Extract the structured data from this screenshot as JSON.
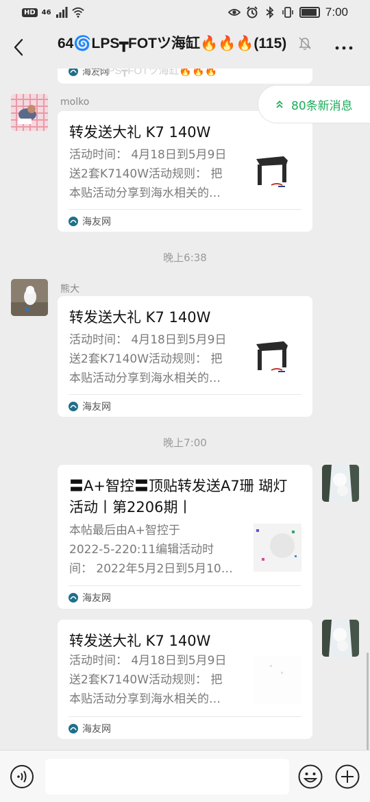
{
  "status_bar": {
    "left_badge": "HD",
    "network": "46",
    "time": "7:00",
    "battery_percent": 90,
    "icons": [
      "hd-icon",
      "signal-icon",
      "wifi-icon",
      "eye-icon",
      "alarm-icon",
      "bluetooth-icon",
      "vibrate-icon",
      "battery-icon"
    ]
  },
  "header": {
    "title": "64🌀LPS┳FOTツ海缸🔥🔥🔥(115)",
    "icons": [
      "back-icon",
      "mute-icon",
      "more-icon"
    ]
  },
  "partial_top": {
    "ghost_title": "ツLPS┳FOTツ海缸🔥🔥🔥",
    "source": "海友网"
  },
  "new_messages": {
    "label": "80条新消息",
    "icon": "double-chevron-up-icon"
  },
  "messages": [
    {
      "sender": "molko",
      "title": "转发送大礼 K7 140W",
      "desc": "活动时间： 4月18日到5月9日\n送2套K7140W活动规则： 把\n本贴活动分享到海水相关的…",
      "source": "海友网"
    },
    {
      "sender": "熊大",
      "title": "转发送大礼 K7 140W",
      "desc": "活动时间： 4月18日到5月9日\n送2套K7140W活动规则： 把\n本贴活动分享到海水相关的…",
      "source": "海友网"
    },
    {
      "sender": "",
      "title": "〓A+智控〓顶贴转发送A7珊 瑚灯活动丨第2206期丨",
      "desc": "本帖最后由A+智控于\n2022-5-220:11编辑活动时\n间： 2022年5月2日到5月10…",
      "source": "海友网"
    },
    {
      "sender": "",
      "title": "转发送大礼 K7 140W",
      "desc": "活动时间： 4月18日到5月9日\n送2套K7140W活动规则： 把\n本贴活动分享到海水相关的…",
      "source": "海友网"
    }
  ],
  "timestamps": [
    "晚上6:38",
    "晚上7:00"
  ],
  "input_bar": {
    "placeholder": "",
    "icons": [
      "voice-icon",
      "emoji-icon",
      "plus-icon"
    ]
  },
  "colors": {
    "background": "#ededed",
    "accent_green": "#1aad5a",
    "card": "#ffffff",
    "secondary_text": "#7a7a7a"
  }
}
